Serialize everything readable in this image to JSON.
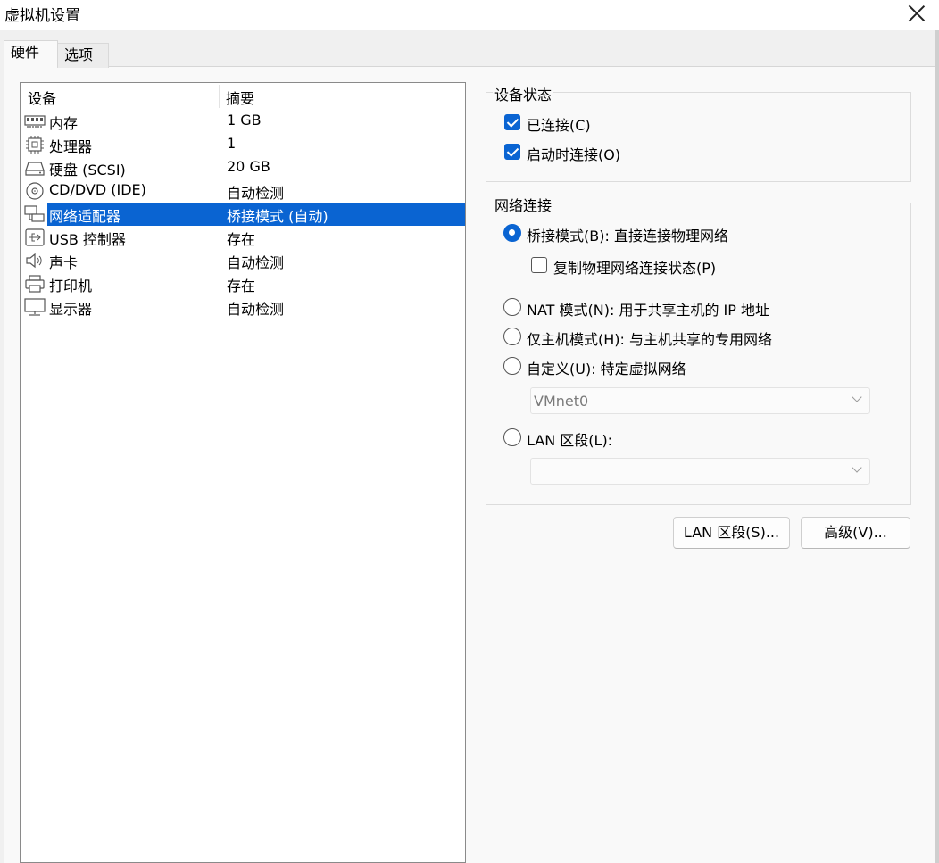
{
  "window": {
    "title": "虚拟机设置"
  },
  "tabs": [
    {
      "label": "硬件",
      "active": true
    },
    {
      "label": "选项",
      "active": false
    }
  ],
  "device_list": {
    "columns": [
      "设备",
      "摘要"
    ],
    "rows": [
      {
        "icon": "memory-icon",
        "name": "内存",
        "summary": "1 GB",
        "selected": false
      },
      {
        "icon": "processor-icon",
        "name": "处理器",
        "summary": "1",
        "selected": false
      },
      {
        "icon": "hard-disk-icon",
        "name": "硬盘 (SCSI)",
        "summary": "20 GB",
        "selected": false
      },
      {
        "icon": "cd-dvd-icon",
        "name": "CD/DVD (IDE)",
        "summary": "自动检测",
        "selected": false
      },
      {
        "icon": "network-adapter-icon",
        "name": "网络适配器",
        "summary": "桥接模式 (自动)",
        "selected": true
      },
      {
        "icon": "usb-icon",
        "name": "USB 控制器",
        "summary": "存在",
        "selected": false
      },
      {
        "icon": "sound-icon",
        "name": "声卡",
        "summary": "自动检测",
        "selected": false
      },
      {
        "icon": "printer-icon",
        "name": "打印机",
        "summary": "存在",
        "selected": false
      },
      {
        "icon": "display-icon",
        "name": "显示器",
        "summary": "自动检测",
        "selected": false
      }
    ]
  },
  "device_status": {
    "title": "设备状态",
    "connected": {
      "label": "已连接(C)",
      "checked": true
    },
    "connect_at_power_on": {
      "label": "启动时连接(O)",
      "checked": true
    }
  },
  "network_connection": {
    "title": "网络连接",
    "bridged": {
      "label": "桥接模式(B): 直接连接物理网络",
      "selected": true
    },
    "replicate": {
      "label": "复制物理网络连接状态(P)",
      "checked": false
    },
    "nat": {
      "label": "NAT 模式(N): 用于共享主机的 IP 地址",
      "selected": false
    },
    "host_only": {
      "label": "仅主机模式(H): 与主机共享的专用网络",
      "selected": false
    },
    "custom": {
      "label": "自定义(U): 特定虚拟网络",
      "selected": false
    },
    "custom_network": {
      "value": "VMnet0"
    },
    "lan_segment": {
      "label": "LAN 区段(L):",
      "selected": false
    },
    "lan_segment_select": {
      "value": ""
    }
  },
  "buttons": {
    "lan_segments": "LAN 区段(S)...",
    "advanced": "高级(V)..."
  },
  "colors": {
    "selection": "#0a64d2",
    "accent": "#0a64d2",
    "background": "#f9f9f9"
  }
}
